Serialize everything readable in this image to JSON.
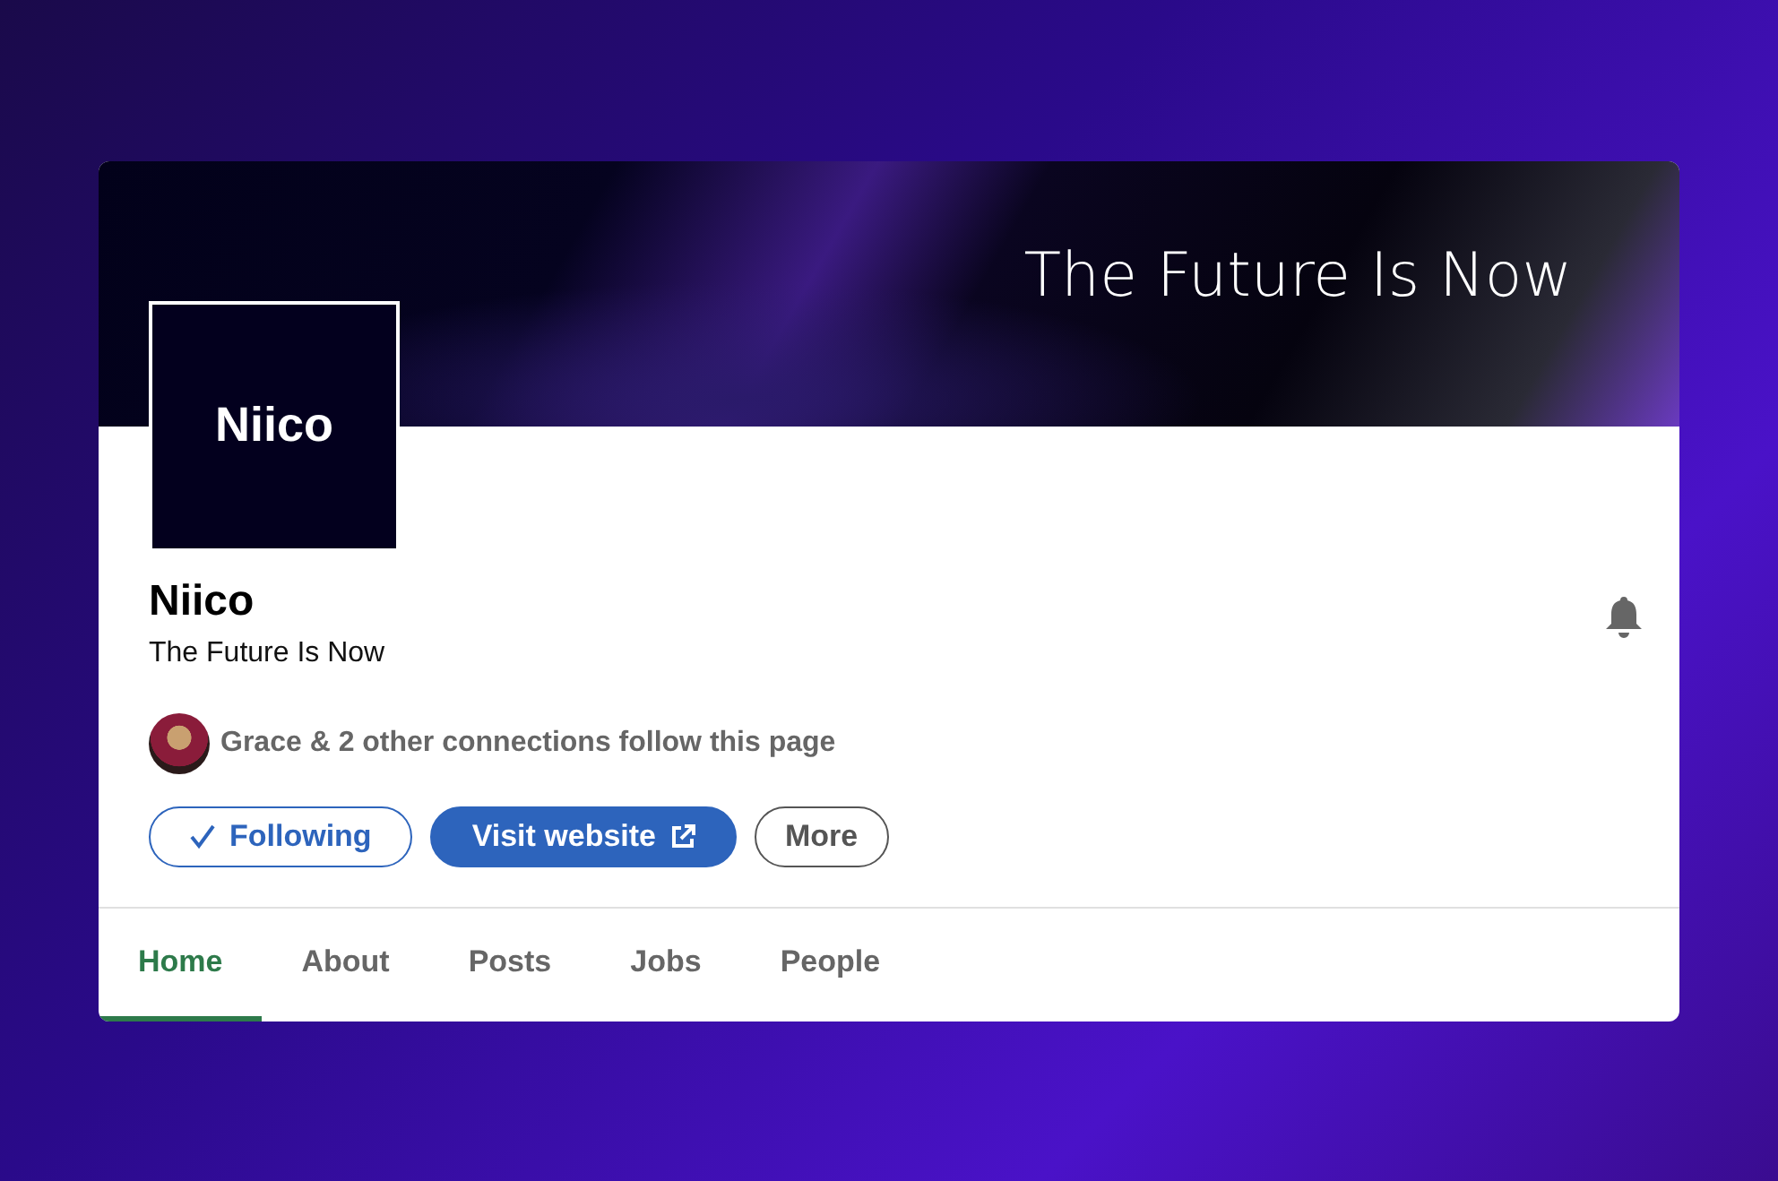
{
  "banner": {
    "headline": "The Future Is Now"
  },
  "logo": {
    "text": "Niico"
  },
  "company": {
    "name": "Niico",
    "tagline": "The Future Is Now"
  },
  "connections": {
    "text": "Grace & 2 other connections follow this page"
  },
  "buttons": [
    {
      "label": "Following",
      "kind": "following"
    },
    {
      "label": "Visit website",
      "kind": "primary"
    },
    {
      "label": "More",
      "kind": "secondary"
    }
  ],
  "tabs": [
    {
      "label": "Home",
      "selected": true
    },
    {
      "label": "About",
      "selected": false
    },
    {
      "label": "Posts",
      "selected": false
    },
    {
      "label": "Jobs",
      "selected": false
    },
    {
      "label": "People",
      "selected": false
    }
  ]
}
